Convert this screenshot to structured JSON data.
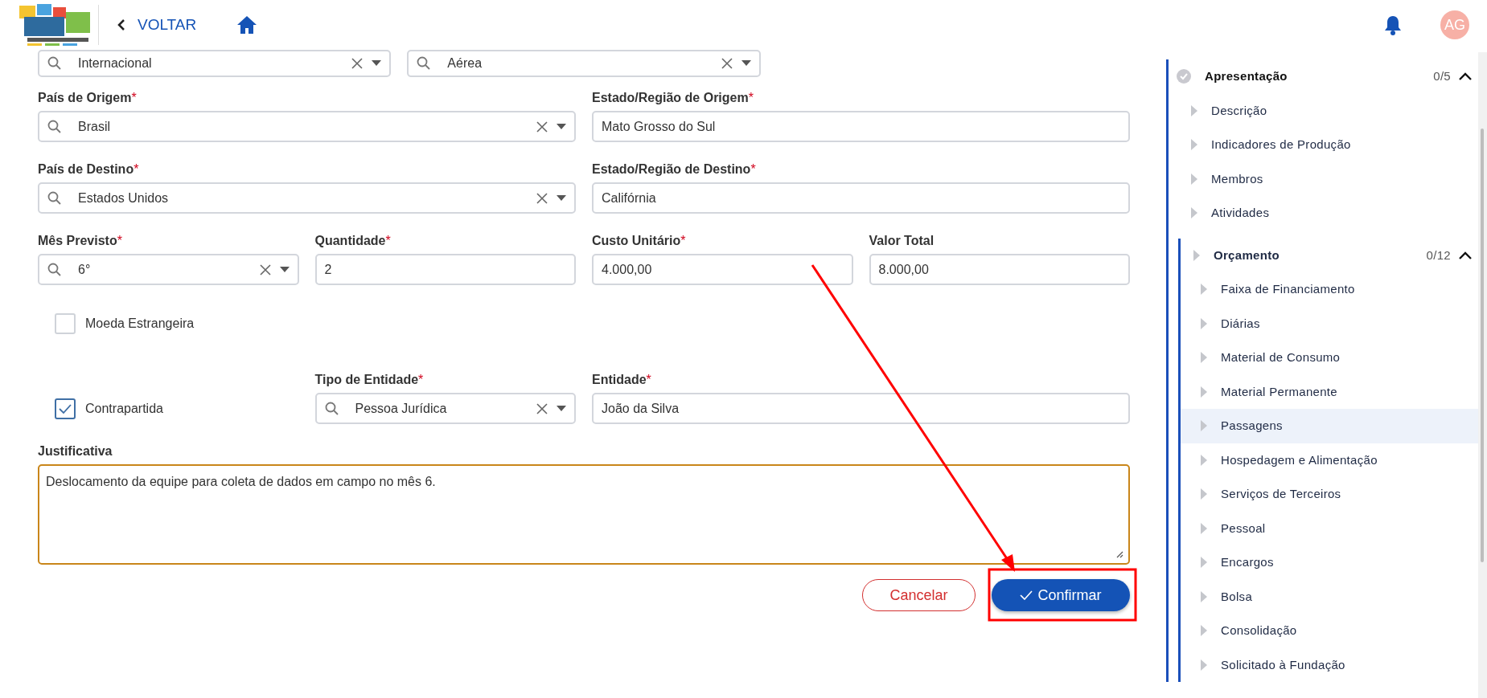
{
  "header": {
    "back_label": "VOLTAR",
    "avatar_initials": "AG"
  },
  "form": {
    "rows": [
      [
        {
          "kind": "select",
          "value": "Internacional"
        },
        {
          "kind": "select",
          "value": "Aérea"
        }
      ],
      [
        {
          "kind": "select",
          "label": "País de Origem",
          "required_mark": "*",
          "value": "Brasil"
        },
        {
          "kind": "text",
          "label": "Estado/Região de Origem",
          "required_mark": "*",
          "value": "Mato Grosso do Sul"
        }
      ],
      [
        {
          "kind": "select",
          "label": "País de Destino",
          "required_mark": "*",
          "value": "Estados Unidos"
        },
        {
          "kind": "text",
          "label": "Estado/Região de Destino",
          "required_mark": "*",
          "value": "Califórnia"
        }
      ],
      [
        {
          "kind": "select",
          "label": "Mês Previsto",
          "required_mark": "*",
          "value": "6°"
        },
        {
          "kind": "text",
          "label": "Quantidade",
          "required_mark": "*",
          "value": "2"
        },
        {
          "kind": "text",
          "label": "Custo Unitário",
          "required_mark": "*",
          "value": "4.000,00"
        },
        {
          "kind": "text",
          "label": "Valor Total",
          "value": "8.000,00"
        }
      ],
      [
        {
          "kind": "checkbox",
          "label": "Moeda Estrangeira",
          "checked": false
        }
      ],
      [
        {
          "kind": "checkbox",
          "label": "Contrapartida",
          "checked": true
        },
        {
          "kind": "select",
          "label": "Tipo de Entidade",
          "required_mark": "*",
          "value": "Pessoa Jurídica"
        },
        {
          "kind": "text",
          "label": "Entidade",
          "required_mark": "*",
          "value": "João da Silva"
        }
      ]
    ],
    "justification": {
      "label": "Justificativa",
      "value": "Deslocamento da equipe para coleta de dados em campo no mês 6."
    },
    "buttons": [
      {
        "kind": "secondary",
        "label": "Cancelar"
      },
      {
        "kind": "primary",
        "label": "Confirmar"
      }
    ]
  },
  "sidebar": {
    "items": [
      {
        "label": "Apresentação",
        "count": "0/5",
        "expanded": true,
        "selected": false,
        "children": [
          {
            "label": "Descrição",
            "selected": false
          },
          {
            "label": "Indicadores de Produção",
            "selected": false
          },
          {
            "label": "Membros",
            "selected": false
          },
          {
            "label": "Atividades",
            "selected": false
          },
          {
            "label": "Orçamento",
            "count": "0/12",
            "expanded": true,
            "selected": false,
            "children": [
              {
                "label": "Faixa de Financiamento",
                "selected": false
              },
              {
                "label": "Diárias",
                "selected": false
              },
              {
                "label": "Material de Consumo",
                "selected": false
              },
              {
                "label": "Material Permanente",
                "selected": false
              },
              {
                "label": "Passagens",
                "selected": true
              },
              {
                "label": "Hospedagem e Alimentação",
                "selected": false
              },
              {
                "label": "Serviços de Terceiros",
                "selected": false
              },
              {
                "label": "Pessoal",
                "selected": false
              },
              {
                "label": "Encargos",
                "selected": false
              },
              {
                "label": "Bolsa",
                "selected": false
              },
              {
                "label": "Consolidação",
                "selected": false
              },
              {
                "label": "Solicitado à Fundação",
                "selected": false
              }
            ]
          }
        ]
      }
    ]
  }
}
